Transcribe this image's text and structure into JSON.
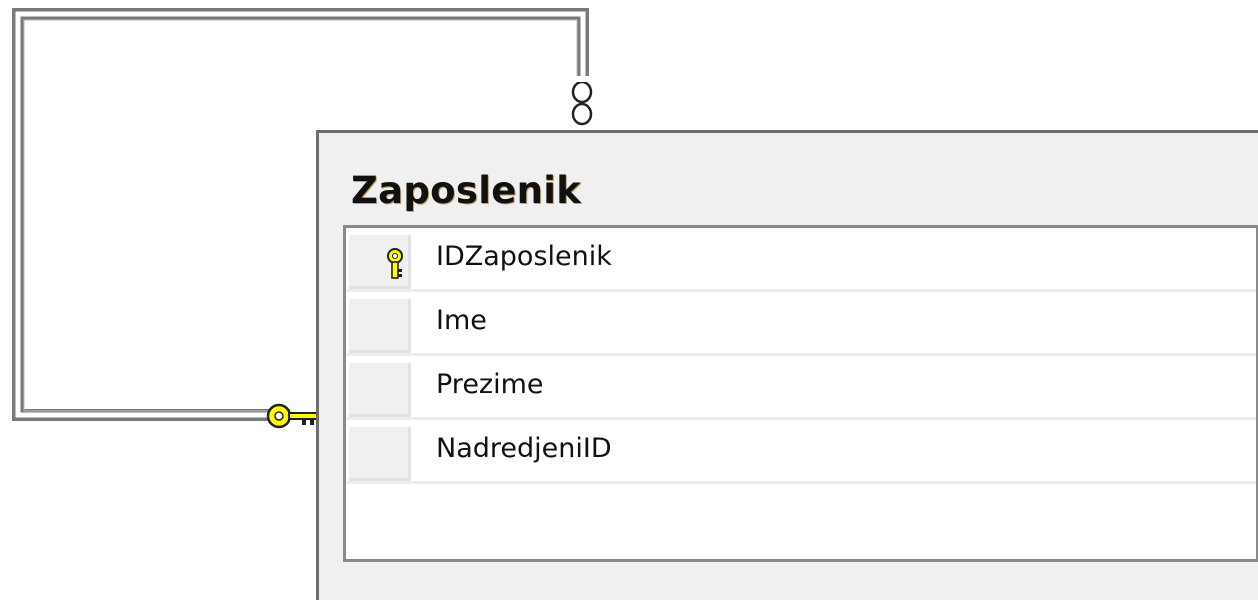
{
  "diagram": {
    "table": {
      "title": "Zaposlenik",
      "columns": [
        {
          "name": "IDZaposlenik",
          "primary_key": true
        },
        {
          "name": "Ime",
          "primary_key": false
        },
        {
          "name": "Prezime",
          "primary_key": false
        },
        {
          "name": "NadredjeniID",
          "primary_key": false
        }
      ]
    },
    "relationship": {
      "one_end_icon": "key-icon",
      "many_end_icon": "infinity-icon"
    }
  },
  "colors": {
    "line": "#7a7a7a",
    "key_yellow": "#ffff00",
    "table_border": "#6d6d6d"
  }
}
